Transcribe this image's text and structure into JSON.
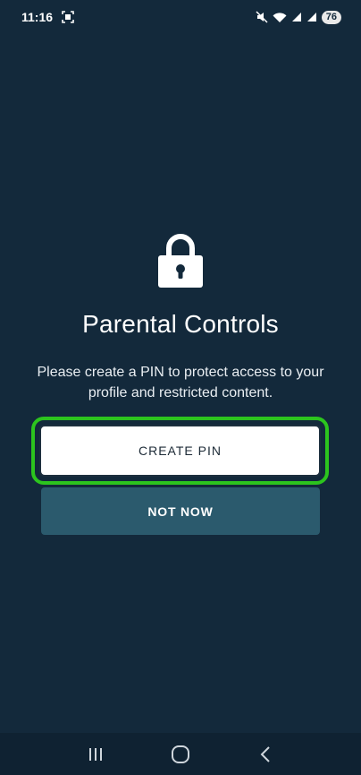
{
  "status_bar": {
    "time": "11:16",
    "battery": "76",
    "icons": [
      "screenshot-icon",
      "mute-icon",
      "wifi-icon",
      "signal-icon",
      "signal-icon",
      "battery-icon"
    ]
  },
  "main": {
    "icon": "lock-icon",
    "title": "Parental Controls",
    "description": "Please create a PIN to protect access to your profile and restricted content.",
    "create_pin_label": "CREATE PIN",
    "not_now_label": "NOT NOW"
  },
  "nav_bar": {
    "icons": [
      "recents-icon",
      "home-icon",
      "back-icon"
    ]
  },
  "colors": {
    "background": "#13293b",
    "highlight": "#2cc41e",
    "secondary_button": "#2b5a6d"
  }
}
